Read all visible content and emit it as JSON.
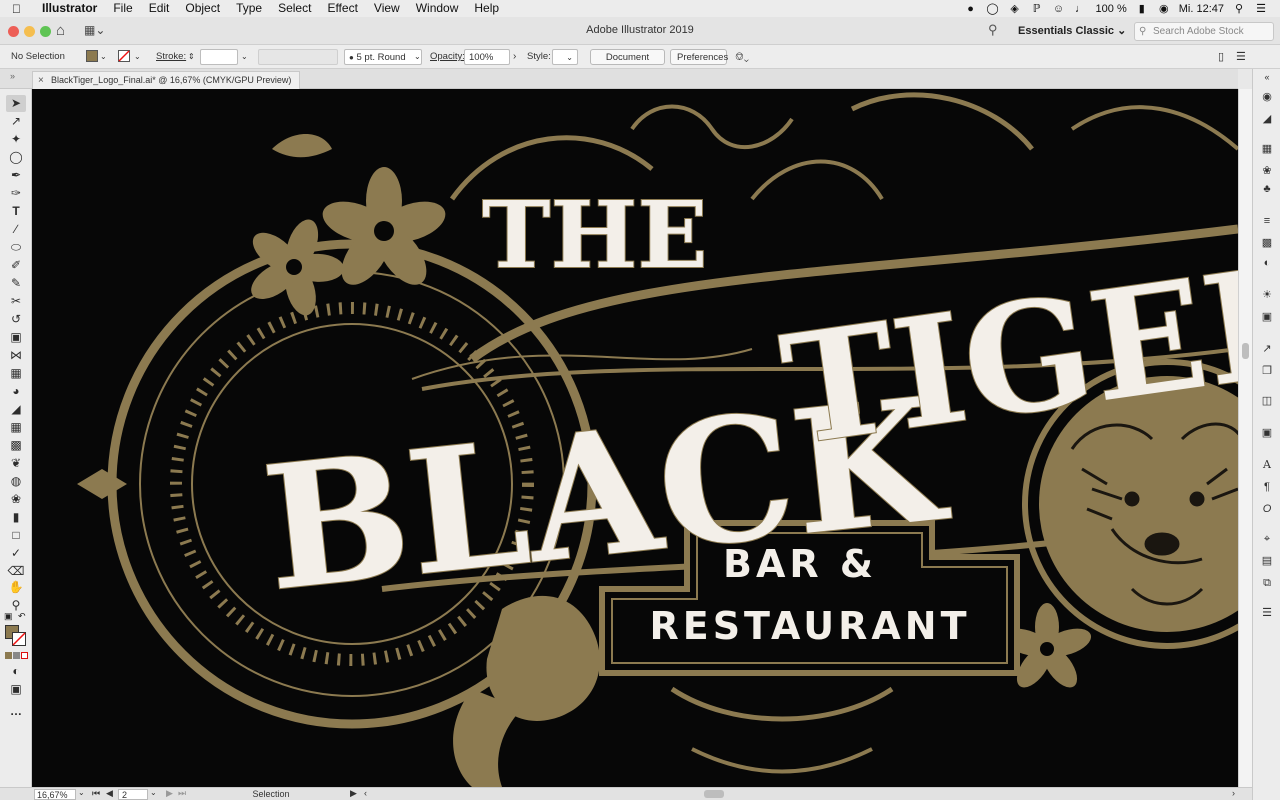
{
  "menubar": {
    "app_name": "Illustrator",
    "items": [
      "File",
      "Edit",
      "Object",
      "Type",
      "Select",
      "Effect",
      "View",
      "Window",
      "Help"
    ],
    "battery": "100 %",
    "clock": "Mi. 12:47"
  },
  "appbar": {
    "window_title": "Adobe Illustrator 2019",
    "workspace": "Essentials Classic",
    "search_placeholder": "Search Adobe Stock"
  },
  "control_bar": {
    "selection_status": "No Selection",
    "stroke_label": "Stroke:",
    "brush_label": "5 pt. Round",
    "opacity_label": "Opacity:",
    "opacity_value": "100%",
    "style_label": "Style:",
    "document_setup": "Document Setup",
    "preferences": "Preferences"
  },
  "document": {
    "tab_title": "BlackTiger_Logo_Final.ai* @ 16,67% (CMYK/GPU Preview)",
    "zoom": "16,67%",
    "artboard": "2",
    "status_tool": "Selection"
  },
  "artwork": {
    "title_the": "THE",
    "title_black": "BLACK",
    "title_tiger": "TIGER",
    "sub_line1": "BAR &",
    "sub_line2": "RESTAURANT"
  },
  "colors": {
    "gold": "#8c7a50",
    "cream": "#f3efe9",
    "canvas_bg": "#070707"
  }
}
